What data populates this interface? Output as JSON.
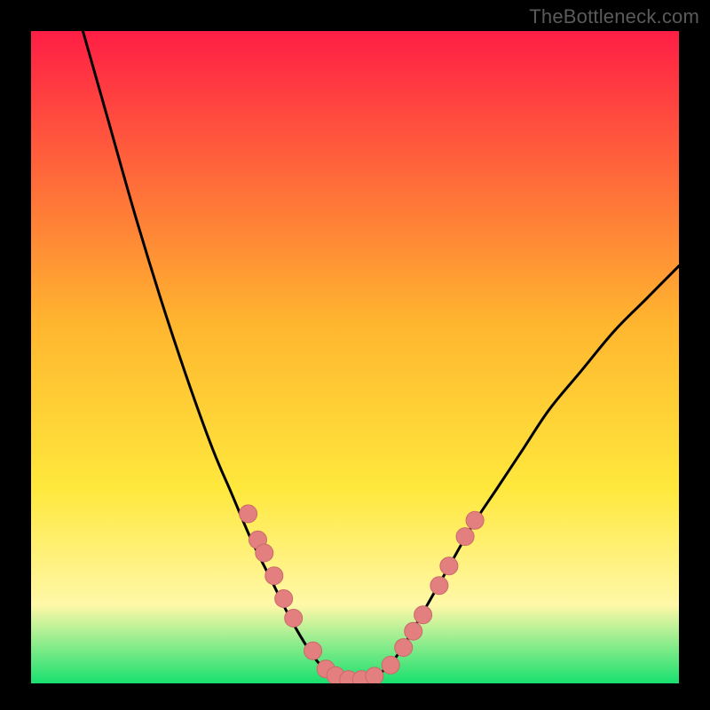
{
  "watermark": "TheBottleneck.com",
  "colors": {
    "frame": "#000000",
    "watermark": "#5a5a5a",
    "gradient_top": "#ff1e45",
    "gradient_mid1": "#ffb62f",
    "gradient_mid2": "#ffe83c",
    "gradient_mid3": "#fff8a8",
    "gradient_bottom": "#18e06f",
    "curve": "#000000",
    "marker_fill": "#e37f7f",
    "marker_stroke": "#c96a6a"
  },
  "chart_data": {
    "type": "line",
    "title": "",
    "xlabel": "",
    "ylabel": "",
    "xlim": [
      0,
      100
    ],
    "ylim": [
      0,
      100
    ],
    "grid": false,
    "legend": false,
    "description": "Bottleneck-style V-shaped curve over a vertical rainbow gradient. Y maps to bottleneck % (top=high=red, bottom=low=green). Curve reaches ~0 between x≈44 and x≈56.",
    "series": [
      {
        "name": "bottleneck-curve",
        "x": [
          8,
          12,
          16,
          20,
          24,
          28,
          31,
          34,
          37,
          40,
          43,
          45,
          47,
          49,
          51,
          53,
          55,
          57,
          60,
          64,
          68,
          72,
          76,
          80,
          85,
          90,
          95,
          100
        ],
        "y": [
          100,
          86,
          72,
          59,
          47,
          36,
          29,
          22,
          16,
          10,
          5,
          2.5,
          1,
          0.5,
          0.5,
          1,
          2.5,
          5,
          10,
          17,
          24,
          30,
          36,
          42,
          48,
          54,
          59,
          64
        ]
      }
    ],
    "markers": [
      {
        "x": 33.5,
        "y": 26
      },
      {
        "x": 35,
        "y": 22
      },
      {
        "x": 36,
        "y": 20
      },
      {
        "x": 37.5,
        "y": 16.5
      },
      {
        "x": 39,
        "y": 13
      },
      {
        "x": 40.5,
        "y": 10
      },
      {
        "x": 43.5,
        "y": 5
      },
      {
        "x": 45.5,
        "y": 2.2
      },
      {
        "x": 47,
        "y": 1.2
      },
      {
        "x": 49,
        "y": 0.6
      },
      {
        "x": 51,
        "y": 0.6
      },
      {
        "x": 53,
        "y": 1.1
      },
      {
        "x": 55.5,
        "y": 2.8
      },
      {
        "x": 57.5,
        "y": 5.5
      },
      {
        "x": 59,
        "y": 8
      },
      {
        "x": 60.5,
        "y": 10.5
      },
      {
        "x": 63,
        "y": 15
      },
      {
        "x": 64.5,
        "y": 18
      },
      {
        "x": 67,
        "y": 22.5
      },
      {
        "x": 68.5,
        "y": 25
      }
    ]
  }
}
